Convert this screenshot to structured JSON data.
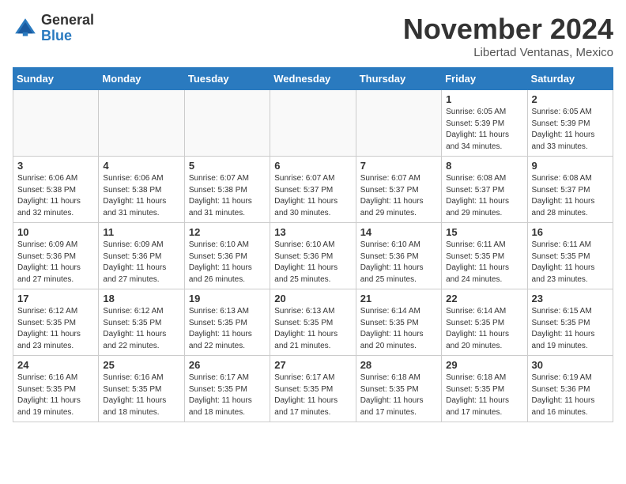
{
  "header": {
    "logo_general": "General",
    "logo_blue": "Blue",
    "month_title": "November 2024",
    "location": "Libertad Ventanas, Mexico"
  },
  "weekdays": [
    "Sunday",
    "Monday",
    "Tuesday",
    "Wednesday",
    "Thursday",
    "Friday",
    "Saturday"
  ],
  "weeks": [
    [
      {
        "day": "",
        "info": ""
      },
      {
        "day": "",
        "info": ""
      },
      {
        "day": "",
        "info": ""
      },
      {
        "day": "",
        "info": ""
      },
      {
        "day": "",
        "info": ""
      },
      {
        "day": "1",
        "info": "Sunrise: 6:05 AM\nSunset: 5:39 PM\nDaylight: 11 hours\nand 34 minutes."
      },
      {
        "day": "2",
        "info": "Sunrise: 6:05 AM\nSunset: 5:39 PM\nDaylight: 11 hours\nand 33 minutes."
      }
    ],
    [
      {
        "day": "3",
        "info": "Sunrise: 6:06 AM\nSunset: 5:38 PM\nDaylight: 11 hours\nand 32 minutes."
      },
      {
        "day": "4",
        "info": "Sunrise: 6:06 AM\nSunset: 5:38 PM\nDaylight: 11 hours\nand 31 minutes."
      },
      {
        "day": "5",
        "info": "Sunrise: 6:07 AM\nSunset: 5:38 PM\nDaylight: 11 hours\nand 31 minutes."
      },
      {
        "day": "6",
        "info": "Sunrise: 6:07 AM\nSunset: 5:37 PM\nDaylight: 11 hours\nand 30 minutes."
      },
      {
        "day": "7",
        "info": "Sunrise: 6:07 AM\nSunset: 5:37 PM\nDaylight: 11 hours\nand 29 minutes."
      },
      {
        "day": "8",
        "info": "Sunrise: 6:08 AM\nSunset: 5:37 PM\nDaylight: 11 hours\nand 29 minutes."
      },
      {
        "day": "9",
        "info": "Sunrise: 6:08 AM\nSunset: 5:37 PM\nDaylight: 11 hours\nand 28 minutes."
      }
    ],
    [
      {
        "day": "10",
        "info": "Sunrise: 6:09 AM\nSunset: 5:36 PM\nDaylight: 11 hours\nand 27 minutes."
      },
      {
        "day": "11",
        "info": "Sunrise: 6:09 AM\nSunset: 5:36 PM\nDaylight: 11 hours\nand 27 minutes."
      },
      {
        "day": "12",
        "info": "Sunrise: 6:10 AM\nSunset: 5:36 PM\nDaylight: 11 hours\nand 26 minutes."
      },
      {
        "day": "13",
        "info": "Sunrise: 6:10 AM\nSunset: 5:36 PM\nDaylight: 11 hours\nand 25 minutes."
      },
      {
        "day": "14",
        "info": "Sunrise: 6:10 AM\nSunset: 5:36 PM\nDaylight: 11 hours\nand 25 minutes."
      },
      {
        "day": "15",
        "info": "Sunrise: 6:11 AM\nSunset: 5:35 PM\nDaylight: 11 hours\nand 24 minutes."
      },
      {
        "day": "16",
        "info": "Sunrise: 6:11 AM\nSunset: 5:35 PM\nDaylight: 11 hours\nand 23 minutes."
      }
    ],
    [
      {
        "day": "17",
        "info": "Sunrise: 6:12 AM\nSunset: 5:35 PM\nDaylight: 11 hours\nand 23 minutes."
      },
      {
        "day": "18",
        "info": "Sunrise: 6:12 AM\nSunset: 5:35 PM\nDaylight: 11 hours\nand 22 minutes."
      },
      {
        "day": "19",
        "info": "Sunrise: 6:13 AM\nSunset: 5:35 PM\nDaylight: 11 hours\nand 22 minutes."
      },
      {
        "day": "20",
        "info": "Sunrise: 6:13 AM\nSunset: 5:35 PM\nDaylight: 11 hours\nand 21 minutes."
      },
      {
        "day": "21",
        "info": "Sunrise: 6:14 AM\nSunset: 5:35 PM\nDaylight: 11 hours\nand 20 minutes."
      },
      {
        "day": "22",
        "info": "Sunrise: 6:14 AM\nSunset: 5:35 PM\nDaylight: 11 hours\nand 20 minutes."
      },
      {
        "day": "23",
        "info": "Sunrise: 6:15 AM\nSunset: 5:35 PM\nDaylight: 11 hours\nand 19 minutes."
      }
    ],
    [
      {
        "day": "24",
        "info": "Sunrise: 6:16 AM\nSunset: 5:35 PM\nDaylight: 11 hours\nand 19 minutes."
      },
      {
        "day": "25",
        "info": "Sunrise: 6:16 AM\nSunset: 5:35 PM\nDaylight: 11 hours\nand 18 minutes."
      },
      {
        "day": "26",
        "info": "Sunrise: 6:17 AM\nSunset: 5:35 PM\nDaylight: 11 hours\nand 18 minutes."
      },
      {
        "day": "27",
        "info": "Sunrise: 6:17 AM\nSunset: 5:35 PM\nDaylight: 11 hours\nand 17 minutes."
      },
      {
        "day": "28",
        "info": "Sunrise: 6:18 AM\nSunset: 5:35 PM\nDaylight: 11 hours\nand 17 minutes."
      },
      {
        "day": "29",
        "info": "Sunrise: 6:18 AM\nSunset: 5:35 PM\nDaylight: 11 hours\nand 17 minutes."
      },
      {
        "day": "30",
        "info": "Sunrise: 6:19 AM\nSunset: 5:36 PM\nDaylight: 11 hours\nand 16 minutes."
      }
    ]
  ]
}
